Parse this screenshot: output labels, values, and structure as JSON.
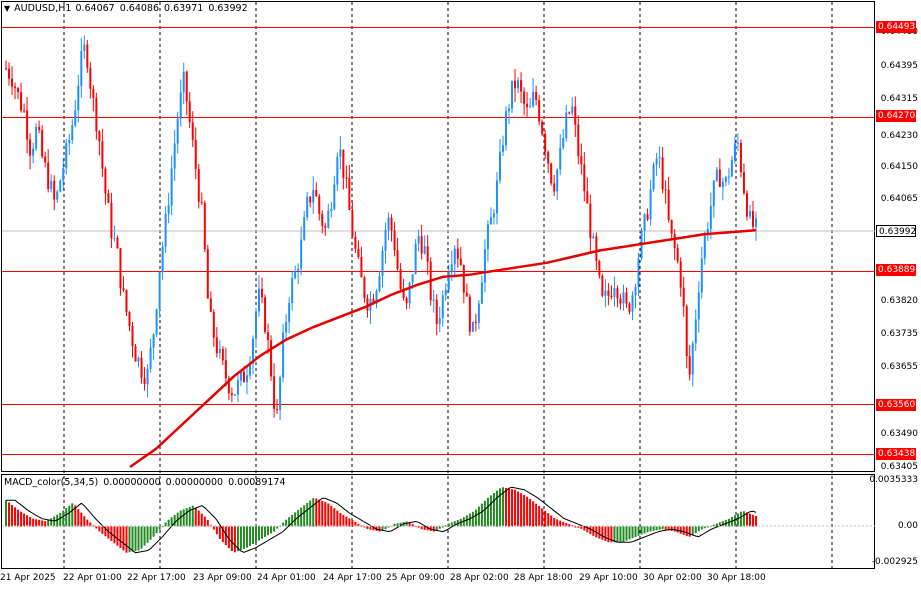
{
  "header": {
    "symbol": "AUDUSD,H1",
    "open": "0.64067",
    "high": "0.64086",
    "low": "0.63971",
    "close": "0.63992"
  },
  "macd_header": {
    "name": "MACD_color(5,34,5)",
    "v1": "0.00000000",
    "v2": "0.00000000",
    "v3": "0.00089174"
  },
  "price_axis": [
    "0.64480",
    "0.64395",
    "0.64315",
    "0.64230",
    "0.64150",
    "0.64065",
    "0.63820",
    "0.63735",
    "0.63655",
    "0.63490",
    "0.63405"
  ],
  "macd_axis": [
    "0.0035333",
    "0.00",
    "-0.002925"
  ],
  "hlines": [
    {
      "label": "0.64493",
      "color": "#ff0000"
    },
    {
      "label": "0.64270",
      "color": "#ff0000"
    },
    {
      "label": "0.63889",
      "color": "#ff0000"
    },
    {
      "label": "0.63560",
      "color": "#ff0000"
    },
    {
      "label": "0.63438",
      "color": "#ff0000"
    }
  ],
  "current_price": {
    "label": "0.63992"
  },
  "time_axis": [
    "21 Apr 2025",
    "22 Apr 01:00",
    "22 Apr 17:00",
    "23 Apr 09:00",
    "24 Apr 01:00",
    "24 Apr 17:00",
    "25 Apr 09:00",
    "28 Apr 02:00",
    "28 Apr 18:00",
    "29 Apr 10:00",
    "30 Apr 02:00",
    "30 Apr 18:00"
  ],
  "colors": {
    "bull": "#1e90ff",
    "bear": "#ff0000",
    "ma": "#e60000",
    "macd_pos": "#228b22",
    "macd_neg": "#ff0000",
    "signal": "#000000",
    "grid": "#000000"
  },
  "chart_data": {
    "type": "candlestick",
    "symbol": "AUDUSD",
    "timeframe": "H1",
    "ylim": [
      0.63405,
      0.6448
    ],
    "indicator": "MACD_color(5,34,5)",
    "indicator_ylim": [
      -0.002925,
      0.0035333
    ],
    "ohlc_path": [
      0.6439,
      0.6437,
      0.6432,
      0.6428,
      0.6419,
      0.6424,
      0.6416,
      0.6411,
      0.6405,
      0.6413,
      0.6419,
      0.6427,
      0.6439,
      0.6445,
      0.6432,
      0.6424,
      0.641,
      0.64,
      0.6394,
      0.6383,
      0.6376,
      0.6369,
      0.6365,
      0.6363,
      0.6374,
      0.639,
      0.6401,
      0.6415,
      0.6428,
      0.6436,
      0.6424,
      0.6413,
      0.6401,
      0.6378,
      0.6372,
      0.6366,
      0.6362,
      0.6359,
      0.6361,
      0.6364,
      0.6371,
      0.6383,
      0.6378,
      0.6366,
      0.6351,
      0.637,
      0.6383,
      0.6388,
      0.6395,
      0.6405,
      0.641,
      0.6403,
      0.6399,
      0.6408,
      0.6421,
      0.6413,
      0.6402,
      0.6392,
      0.6385,
      0.6381,
      0.6384,
      0.6392,
      0.6402,
      0.6398,
      0.6386,
      0.6378,
      0.6388,
      0.6398,
      0.6395,
      0.6384,
      0.6376,
      0.6382,
      0.6391,
      0.6396,
      0.6391,
      0.638,
      0.6373,
      0.6384,
      0.6395,
      0.6402,
      0.6411,
      0.6424,
      0.6432,
      0.6436,
      0.6431,
      0.6427,
      0.6433,
      0.6426,
      0.6418,
      0.641,
      0.6416,
      0.6425,
      0.643,
      0.6419,
      0.641,
      0.64,
      0.639,
      0.6381,
      0.6383,
      0.6387,
      0.6383,
      0.6379,
      0.6384,
      0.6394,
      0.6401,
      0.641,
      0.6418,
      0.641,
      0.6398,
      0.6393,
      0.6385,
      0.636,
      0.6375,
      0.6391,
      0.64,
      0.6408,
      0.6413,
      0.641,
      0.6416,
      0.6421,
      0.641,
      0.6401,
      0.6399
    ],
    "ma_path": [
      0.63405,
      0.6345,
      0.6351,
      0.6357,
      0.6363,
      0.6368,
      0.6372,
      0.6375,
      0.63775,
      0.638,
      0.6383,
      0.63855,
      0.63875,
      0.6388,
      0.6389,
      0.639,
      0.6391,
      0.63925,
      0.6394,
      0.6395,
      0.6396,
      0.6397,
      0.6398,
      0.63985,
      0.6399
    ],
    "macd_path": [
      0.002,
      0.0012,
      0.0006,
      0.0004,
      0.001,
      0.0018,
      0.0006,
      -0.0004,
      -0.0012,
      -0.002,
      -0.0018,
      -0.0008,
      0.0004,
      0.0012,
      0.0016,
      0.0006,
      -0.001,
      -0.002,
      -0.0016,
      -0.001,
      -0.0004,
      0.0006,
      0.0014,
      0.0022,
      0.0018,
      0.001,
      0.0004,
      -0.0002,
      -0.0004,
      0.0002,
      0.0004,
      -0.0002,
      -0.0004,
      0.0002,
      0.0006,
      0.0012,
      0.0022,
      0.003,
      0.0028,
      0.0022,
      0.0014,
      0.0006,
      0.0002,
      -0.0002,
      -0.0008,
      -0.0012,
      -0.0012,
      -0.0008,
      -0.0004,
      -0.0002,
      -0.0004,
      -0.0008,
      -0.0002,
      0.0002,
      0.0006,
      0.0012,
      0.0008
    ]
  }
}
